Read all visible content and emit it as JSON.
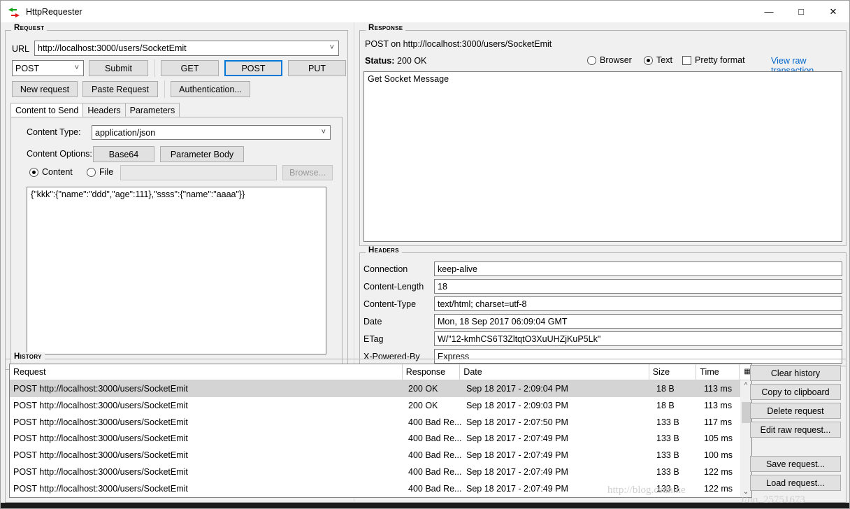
{
  "window": {
    "title": "HttpRequester",
    "icon": "request-response-arrows-icon",
    "minimize": "—",
    "maximize": "□",
    "close": "✕"
  },
  "request": {
    "group_title": "Request",
    "url_label": "URL",
    "url_value": "http://localhost:3000/users/SocketEmit",
    "method_selected": "POST",
    "submit_label": "Submit",
    "verbs": [
      "GET",
      "POST",
      "PUT"
    ],
    "verb_focused": "POST",
    "new_request_label": "New request",
    "paste_request_label": "Paste Request",
    "authentication_label": "Authentication...",
    "tabs": [
      {
        "label": "Content to Send",
        "active": true
      },
      {
        "label": "Headers",
        "active": false
      },
      {
        "label": "Parameters",
        "active": false
      }
    ],
    "content_type_label": "Content Type:",
    "content_type_value": "application/json",
    "content_options_label": "Content Options:",
    "base64_label": "Base64",
    "parameter_body_label": "Parameter Body",
    "content_radio_label": "Content",
    "file_radio_label": "File",
    "source_selected": "Content",
    "file_path_value": "",
    "browse_label": "Browse...",
    "browse_enabled": false,
    "body_value": "{\"kkk\":{\"name\":\"ddd\",\"age\":111},\"ssss\":{\"name\":\"aaaa\"}}"
  },
  "response": {
    "group_title": "Response",
    "summary": "POST on http://localhost:3000/users/SocketEmit",
    "status_label": "Status:",
    "status_value": "200 OK",
    "browser_label": "Browser",
    "text_label": "Text",
    "view_mode_selected": "Text",
    "pretty_format_label": "Pretty format",
    "pretty_format_checked": false,
    "raw_link_label": "View raw transaction",
    "link_color": "#0066cc",
    "body_value": "Get Socket Message"
  },
  "headers": {
    "group_title": "Headers",
    "rows": [
      {
        "name": "Connection",
        "value": "keep-alive"
      },
      {
        "name": "Content-Length",
        "value": "18"
      },
      {
        "name": "Content-Type",
        "value": "text/html; charset=utf-8"
      },
      {
        "name": "Date",
        "value": "Mon, 18 Sep 2017 06:09:04 GMT"
      },
      {
        "name": "ETag",
        "value": "W/\"12-kmhCS6T3ZltqtO3XuUHZjKuP5Lk\""
      },
      {
        "name": "X-Powered-By",
        "value": "Express"
      }
    ]
  },
  "history": {
    "group_title": "History",
    "columns": [
      "Request",
      "Response",
      "Date",
      "Size",
      "Time"
    ],
    "column_picker_icon": "column-chooser-icon",
    "rows": [
      {
        "request": "POST http://localhost:3000/users/SocketEmit",
        "response": "200 OK",
        "date": "Sep 18 2017 - 2:09:04 PM",
        "size": "18 B",
        "time": "113 ms",
        "selected": true
      },
      {
        "request": "POST http://localhost:3000/users/SocketEmit",
        "response": "200 OK",
        "date": "Sep 18 2017 - 2:09:03 PM",
        "size": "18 B",
        "time": "113 ms",
        "selected": false
      },
      {
        "request": "POST http://localhost:3000/users/SocketEmit",
        "response": "400 Bad Re...",
        "date": "Sep 18 2017 - 2:07:50 PM",
        "size": "133 B",
        "time": "117 ms",
        "selected": false
      },
      {
        "request": "POST http://localhost:3000/users/SocketEmit",
        "response": "400 Bad Re...",
        "date": "Sep 18 2017 - 2:07:49 PM",
        "size": "133 B",
        "time": "105 ms",
        "selected": false
      },
      {
        "request": "POST http://localhost:3000/users/SocketEmit",
        "response": "400 Bad Re...",
        "date": "Sep 18 2017 - 2:07:49 PM",
        "size": "133 B",
        "time": "100 ms",
        "selected": false
      },
      {
        "request": "POST http://localhost:3000/users/SocketEmit",
        "response": "400 Bad Re...",
        "date": "Sep 18 2017 - 2:07:49 PM",
        "size": "133 B",
        "time": "122 ms",
        "selected": false
      },
      {
        "request": "POST http://localhost:3000/users/SocketEmit",
        "response": "400 Bad Re...",
        "date": "Sep 18 2017 - 2:07:49 PM",
        "size": "133 B",
        "time": "122 ms",
        "selected": false
      }
    ],
    "buttons": [
      "Clear history",
      "Copy to clipboard",
      "Delete request",
      "Edit raw request...",
      "Save request...",
      "Load request..."
    ]
  },
  "watermark": {
    "line1": "http://blog.csdn.ne",
    "line2": "t/qq_25751673"
  }
}
